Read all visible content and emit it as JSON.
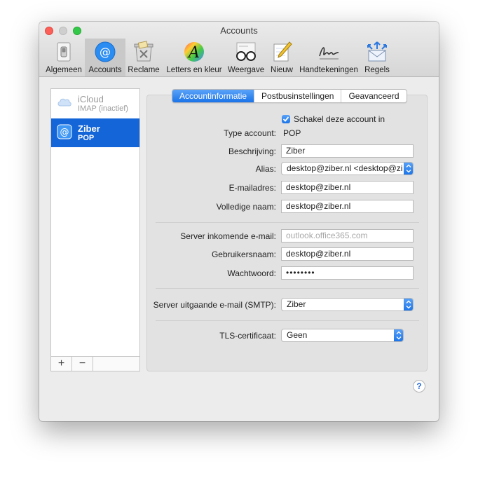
{
  "window": {
    "title": "Accounts"
  },
  "toolbar": {
    "items": [
      {
        "label": "Algemeen",
        "icon": "general-switch-icon"
      },
      {
        "label": "Accounts",
        "icon": "at-sign-icon"
      },
      {
        "label": "Reclame",
        "icon": "junk-mail-icon"
      },
      {
        "label": "Letters en kleur",
        "icon": "fonts-colors-icon"
      },
      {
        "label": "Weergave",
        "icon": "glasses-icon"
      },
      {
        "label": "Nieuw",
        "icon": "pencil-notepad-icon"
      },
      {
        "label": "Handtekeningen",
        "icon": "signature-icon"
      },
      {
        "label": "Regels",
        "icon": "rules-envelope-icon"
      }
    ],
    "selected": "Accounts"
  },
  "sidebar": {
    "accounts": [
      {
        "name": "iCloud",
        "type": "IMAP (inactief)",
        "icon": "cloud-icon",
        "state": "disabled"
      },
      {
        "name": "Ziber",
        "type": "POP",
        "icon": "at-sign-icon",
        "state": "selected"
      }
    ],
    "add_label": "+",
    "remove_label": "−"
  },
  "tabs": [
    {
      "label": "Accountinformatie",
      "active": true
    },
    {
      "label": "Postbusinstellingen",
      "active": false
    },
    {
      "label": "Geavanceerd",
      "active": false
    }
  ],
  "form": {
    "enable_checkbox_label": "Schakel deze account in",
    "enable_checked": true,
    "type_label": "Type account:",
    "type_value": "POP",
    "description_label": "Beschrijving:",
    "description_value": "Ziber",
    "alias_label": "Alias:",
    "alias_value": "desktop@ziber.nl <desktop@zi",
    "email_label": "E-mailadres:",
    "email_value": "desktop@ziber.nl",
    "fullname_label": "Volledige naam:",
    "fullname_value": "desktop@ziber.nl",
    "incoming_label": "Server inkomende e-mail:",
    "incoming_placeholder": "outlook.office365.com",
    "username_label": "Gebruikersnaam:",
    "username_value": "desktop@ziber.nl",
    "password_label": "Wachtwoord:",
    "password_value": "••••••••",
    "smtp_label": "Server uitgaande e-mail (SMTP):",
    "smtp_value": "Ziber",
    "tls_label": "TLS-certificaat:",
    "tls_value": "Geen"
  },
  "help_label": "?",
  "colors": {
    "accent": "#1a73e8",
    "selection": "#1465d8",
    "close": "#fc5f57",
    "zoom": "#34c84a"
  }
}
